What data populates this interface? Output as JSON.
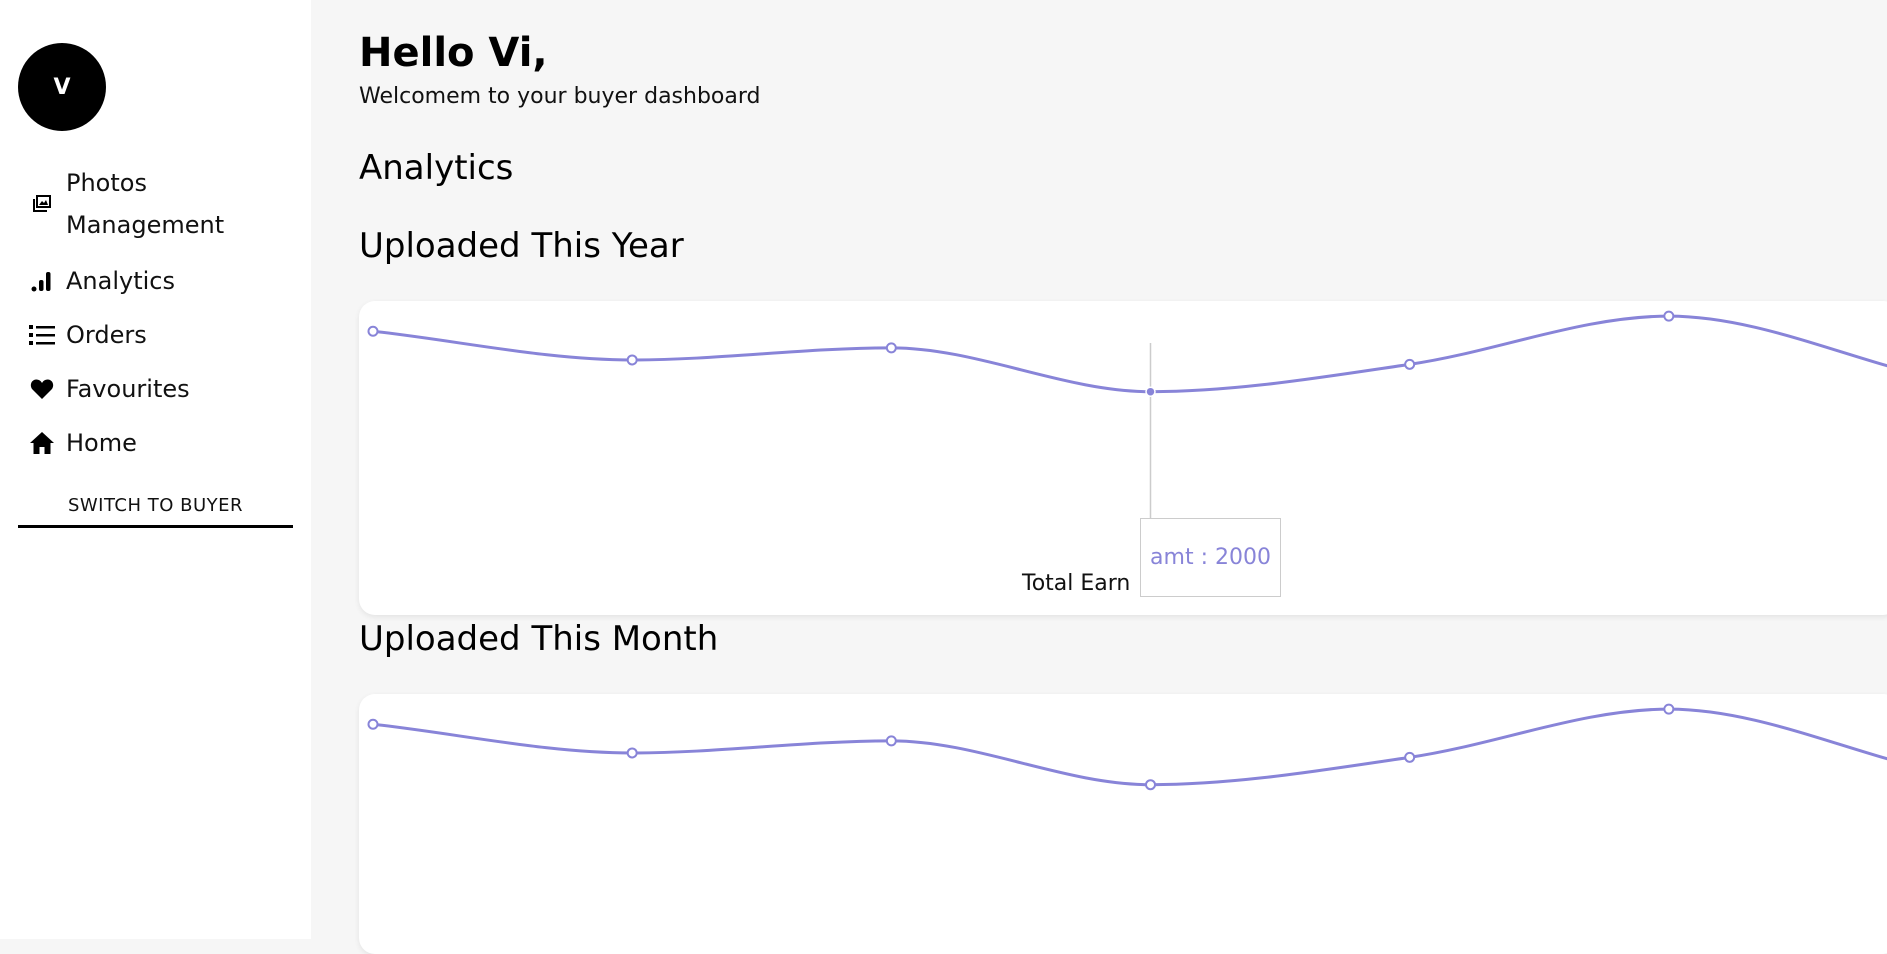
{
  "user": {
    "avatar_initial": "V"
  },
  "sidebar": {
    "items": [
      {
        "label": "Photos Management",
        "icon": "photos-icon"
      },
      {
        "label": "Analytics",
        "icon": "bar-chart-icon"
      },
      {
        "label": "Orders",
        "icon": "list-icon"
      },
      {
        "label": "Favourites",
        "icon": "heart-icon"
      },
      {
        "label": "Home",
        "icon": "home-icon"
      }
    ],
    "switch_label": "SWITCH TO BUYER"
  },
  "header": {
    "title": "Hello Vi,",
    "subtitle": "Welcomem to your buyer dashboard"
  },
  "sections": {
    "analytics": "Analytics",
    "year": "Uploaded This Year",
    "month": "Uploaded This Month"
  },
  "charts": {
    "year_caption": "Total Earn",
    "tooltip_text": "amt : 2000"
  },
  "colors": {
    "line": "#8884d8",
    "cursor": "#cccccc"
  },
  "chart_data": [
    {
      "type": "line",
      "x": [
        0,
        1,
        2,
        3,
        4,
        5,
        6
      ],
      "series": [
        {
          "values": [
            2400,
            2210,
            2290,
            2000,
            2181,
            2500,
            2100
          ]
        }
      ],
      "ylim": [
        0,
        2600
      ],
      "active_index": 3
    },
    {
      "type": "line",
      "x": [
        0,
        1,
        2,
        3,
        4,
        5,
        6
      ],
      "series": [
        {
          "values": [
            2400,
            2210,
            2290,
            2000,
            2181,
            2500,
            2100
          ]
        }
      ],
      "ylim": [
        0,
        2600
      ]
    }
  ]
}
